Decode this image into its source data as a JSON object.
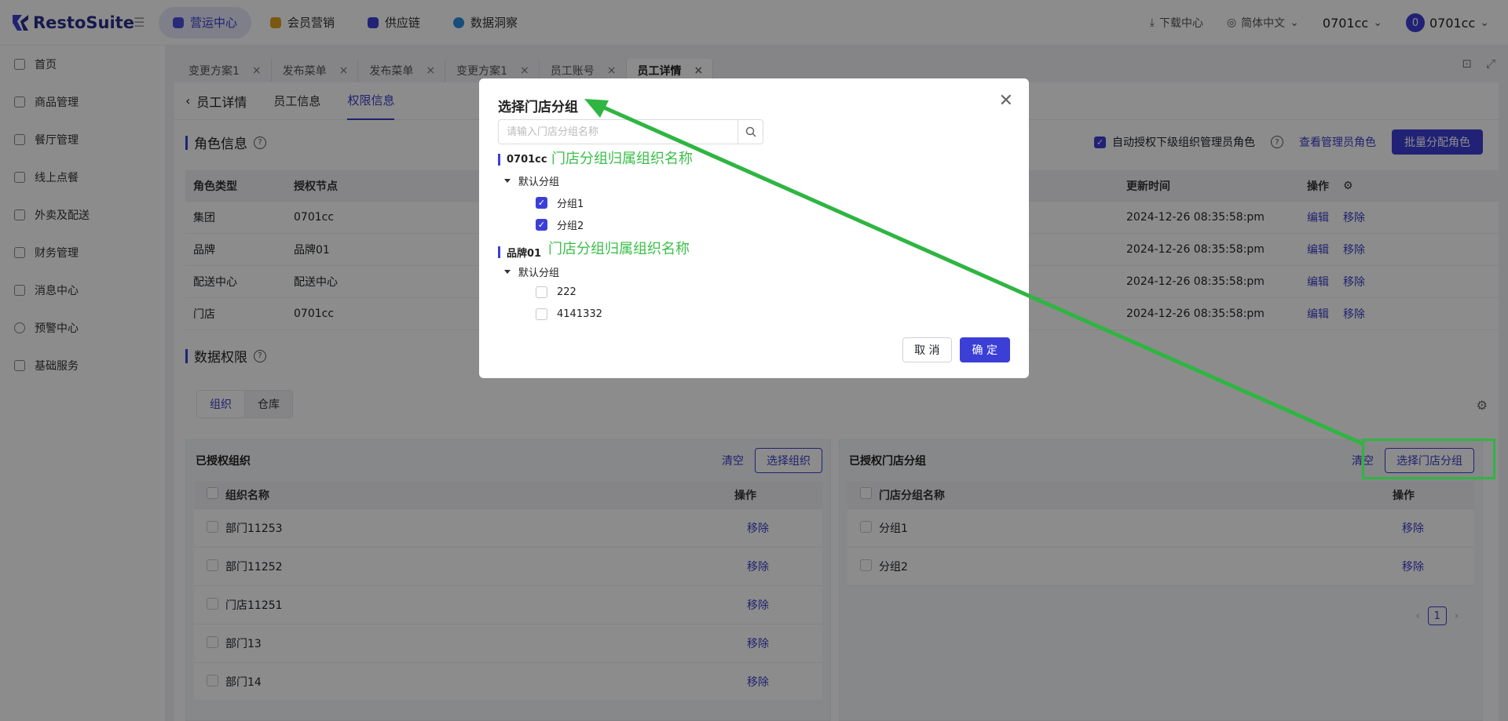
{
  "app": {
    "name": "RestoSuite",
    "top_nav": [
      "营运中心",
      "会员营销",
      "供应链",
      "数据洞察"
    ],
    "top_nav_dot_colors": [
      "#4b4fdc",
      "#e0a020",
      "#3c3fd6",
      "#2c8cdc"
    ],
    "download_center": "下载中心",
    "language": "简体中文",
    "org": "0701cc",
    "user_initial": "0",
    "user_name": "0701cc"
  },
  "sidebar": {
    "items": [
      "首页",
      "商品管理",
      "餐厅管理",
      "线上点餐",
      "外卖及配送",
      "财务管理",
      "消息中心",
      "预警中心",
      "基础服务"
    ]
  },
  "page_tabs": [
    "变更方案1",
    "发布菜单",
    "发布菜单",
    "变更方案1",
    "员工账号",
    "员工详情"
  ],
  "subheader": {
    "back": "员工详情",
    "tabs": [
      "员工信息",
      "权限信息"
    ]
  },
  "roles": {
    "title": "角色信息",
    "auto_grant": "自动授权下级组织管理员角色",
    "view_admin": "查看管理员角色",
    "batch_assign": "批量分配角色",
    "columns": [
      "角色类型",
      "授权节点",
      "更新时间",
      "操作"
    ],
    "rows": [
      {
        "type": "集团",
        "node": "0701cc",
        "time": "2024-12-26 08:35:58:pm"
      },
      {
        "type": "品牌",
        "node": "品牌01",
        "time": "2024-12-26 08:35:58:pm"
      },
      {
        "type": "配送中心",
        "node": "配送中心",
        "time": "2024-12-26 08:35:58:pm"
      },
      {
        "type": "门店",
        "node": "0701cc",
        "time": "2024-12-26 08:35:58:pm"
      }
    ],
    "edit": "编辑",
    "remove": "移除"
  },
  "data_perm": {
    "title": "数据权限",
    "tabs": [
      "组织",
      "仓库"
    ]
  },
  "left_panel": {
    "title": "已授权组织",
    "clear": "清空",
    "select": "选择组织",
    "col_name": "组织名称",
    "col_op": "操作",
    "rows": [
      "部门11253",
      "部门11252",
      "门店11251",
      "部门13",
      "部门14"
    ],
    "remove": "移除"
  },
  "right_panel": {
    "title": "已授权门店分组",
    "clear": "清空",
    "select": "选择门店分组",
    "col_name": "门店分组名称",
    "col_op": "操作",
    "rows": [
      "分组1",
      "分组2"
    ],
    "remove": "移除",
    "page": "1"
  },
  "dialog": {
    "title": "选择门店分组",
    "search_placeholder": "请输入门店分组名称",
    "groups": [
      {
        "org": "0701cc",
        "note": "门店分组归属组织名称",
        "node": "默认分组",
        "leaves": [
          {
            "label": "分组1",
            "checked": true
          },
          {
            "label": "分组2",
            "checked": true
          }
        ]
      },
      {
        "org": "品牌01",
        "note": "门店分组归属组织名称",
        "node": "默认分组",
        "leaves": [
          {
            "label": "222",
            "checked": false
          },
          {
            "label": "4141332",
            "checked": false
          }
        ]
      }
    ],
    "cancel": "取 消",
    "ok": "确 定"
  },
  "colors": {
    "primary": "#3c3fd6",
    "annotation": "#2fb542"
  }
}
